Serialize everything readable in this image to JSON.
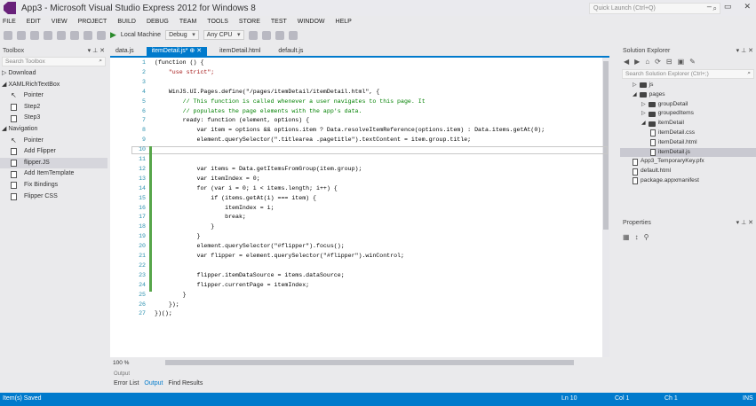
{
  "window": {
    "title": "App3 - Microsoft Visual Studio Express 2012 for Windows 8",
    "quick_launch": "Quick Launch (Ctrl+Q)",
    "buttons": [
      "–",
      "▭",
      "✕"
    ]
  },
  "menu": [
    "FILE",
    "EDIT",
    "VIEW",
    "PROJECT",
    "BUILD",
    "DEBUG",
    "TEAM",
    "TOOLS",
    "STORE",
    "TEST",
    "WINDOW",
    "HELP"
  ],
  "toolbar": {
    "run_target": "Local Machine",
    "config": "Debug",
    "platform": "Any CPU"
  },
  "toolbox": {
    "title": "Toolbox",
    "search_placeholder": "Search Toolbox",
    "items": [
      {
        "label": "Download",
        "kind": "cat",
        "arrow": "▷"
      },
      {
        "label": "XAMLRichTextBox",
        "kind": "cat",
        "arrow": "◢"
      },
      {
        "label": "Pointer",
        "kind": "sub",
        "icon": "pointer"
      },
      {
        "label": "Step2",
        "kind": "sub",
        "icon": "snippet"
      },
      {
        "label": "Step3",
        "kind": "sub",
        "icon": "snippet"
      },
      {
        "label": "Navigation",
        "kind": "cat",
        "arrow": "◢"
      },
      {
        "label": "Pointer",
        "kind": "sub",
        "icon": "pointer"
      },
      {
        "label": "Add Flipper",
        "kind": "sub",
        "icon": "snippet"
      },
      {
        "label": "flipper.JS",
        "kind": "sub",
        "icon": "snippet",
        "selected": true
      },
      {
        "label": "Add ItemTemplate",
        "kind": "sub",
        "icon": "snippet"
      },
      {
        "label": "Fix Bindings",
        "kind": "sub",
        "icon": "snippet"
      },
      {
        "label": "Flipper CSS",
        "kind": "sub",
        "icon": "snippet"
      }
    ]
  },
  "doc_tabs": [
    {
      "label": "data.js",
      "active": false
    },
    {
      "label": "itemDetail.js*  ⊕ ✕",
      "active": true
    },
    {
      "label": "itemDetail.html",
      "active": false
    },
    {
      "label": "default.js",
      "active": false
    }
  ],
  "editor": {
    "lines": [
      {
        "n": "1",
        "t": "(function () {",
        "c": "#000"
      },
      {
        "n": "2",
        "t": "    \"use strict\";",
        "c": "#a31515"
      },
      {
        "n": "3",
        "t": "",
        "c": "#000"
      },
      {
        "n": "4",
        "t": "    WinJS.UI.Pages.define(\"/pages/itemDetail/itemDetail.html\", {",
        "c": "#000"
      },
      {
        "n": "5",
        "t": "        // This function is called whenever a user navigates to this page. It",
        "c": "#008000"
      },
      {
        "n": "6",
        "t": "        // populates the page elements with the app's data.",
        "c": "#008000"
      },
      {
        "n": "7",
        "t": "        ready: function (element, options) {",
        "c": "#000"
      },
      {
        "n": "8",
        "t": "            var item = options && options.item ? Data.resolveItemReference(options.item) : Data.items.getAt(0);",
        "c": "#000"
      },
      {
        "n": "9",
        "t": "            element.querySelector(\".titlearea .pagetitle\").textContent = item.group.title;",
        "c": "#000"
      },
      {
        "n": "10",
        "t": "",
        "c": "#000"
      },
      {
        "n": "11",
        "t": "",
        "c": "#000"
      },
      {
        "n": "12",
        "t": "            var items = Data.getItemsFromGroup(item.group);",
        "c": "#000"
      },
      {
        "n": "13",
        "t": "            var itemIndex = 0;",
        "c": "#000"
      },
      {
        "n": "14",
        "t": "            for (var i = 0; i < items.length; i++) {",
        "c": "#000"
      },
      {
        "n": "15",
        "t": "                if (items.getAt(i) === item) {",
        "c": "#000"
      },
      {
        "n": "16",
        "t": "                    itemIndex = i;",
        "c": "#000"
      },
      {
        "n": "17",
        "t": "                    break;",
        "c": "#000"
      },
      {
        "n": "18",
        "t": "                }",
        "c": "#000"
      },
      {
        "n": "19",
        "t": "            }",
        "c": "#000"
      },
      {
        "n": "20",
        "t": "            element.querySelector(\"#flipper\").focus();",
        "c": "#000"
      },
      {
        "n": "21",
        "t": "            var flipper = element.querySelector(\"#flipper\").winControl;",
        "c": "#000"
      },
      {
        "n": "22",
        "t": "",
        "c": "#000"
      },
      {
        "n": "23",
        "t": "            flipper.itemDataSource = items.dataSource;",
        "c": "#000"
      },
      {
        "n": "24",
        "t": "            flipper.currentPage = itemIndex;",
        "c": "#000"
      },
      {
        "n": "25",
        "t": "        }",
        "c": "#000"
      },
      {
        "n": "26",
        "t": "    });",
        "c": "#000"
      },
      {
        "n": "27",
        "t": "})();",
        "c": "#000"
      }
    ],
    "zoom": "100 %"
  },
  "output": {
    "title": "Output",
    "tabs": [
      "Error List",
      "Output",
      "Find Results"
    ]
  },
  "solution_explorer": {
    "title": "Solution Explorer",
    "search_placeholder": "Search Solution Explorer (Ctrl+;)",
    "items": [
      {
        "label": "js",
        "depth": 1,
        "type": "folder",
        "arrow": "▷"
      },
      {
        "label": "pages",
        "depth": 1,
        "type": "folder",
        "arrow": "◢"
      },
      {
        "label": "groupDetail",
        "depth": 2,
        "type": "folder",
        "arrow": "▷"
      },
      {
        "label": "groupedItems",
        "depth": 2,
        "type": "folder",
        "arrow": "▷"
      },
      {
        "label": "itemDetail",
        "depth": 2,
        "type": "folder",
        "arrow": "◢"
      },
      {
        "label": "itemDetail.css",
        "depth": 3,
        "type": "file"
      },
      {
        "label": "itemDetail.html",
        "depth": 3,
        "type": "file"
      },
      {
        "label": "itemDetail.js",
        "depth": 3,
        "type": "file",
        "selected": true
      },
      {
        "label": "App3_TemporaryKey.pfx",
        "depth": 1,
        "type": "file"
      },
      {
        "label": "default.html",
        "depth": 1,
        "type": "file"
      },
      {
        "label": "package.appxmanifest",
        "depth": 1,
        "type": "file"
      }
    ]
  },
  "properties": {
    "title": "Properties"
  },
  "status": {
    "message": "Item(s) Saved",
    "ln": "Ln 10",
    "col": "Col 1",
    "ch": "Ch 1",
    "ins": "INS"
  },
  "colors": {
    "accent": "#007acc",
    "comment": "#008000",
    "string": "#a31515",
    "line_number": "#2b91af"
  }
}
